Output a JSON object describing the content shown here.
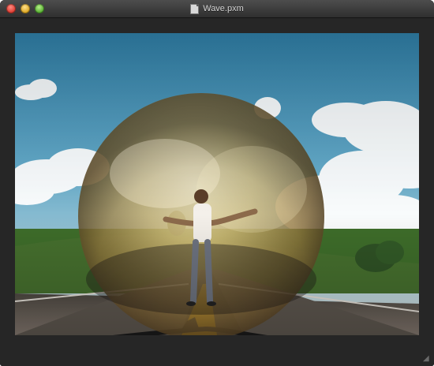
{
  "window": {
    "title": "Wave.pxm"
  },
  "controls": {
    "close": "close-icon",
    "minimize": "minimize-icon",
    "zoom": "zoom-icon"
  },
  "colors": {
    "window_background": "#262626",
    "sky_top": "#3d86aa",
    "road": "#6f655d",
    "road_line": "#f0b000",
    "sphere_glow": "#f4d58a"
  },
  "image": {
    "description_icon": "photo-image-icon"
  },
  "statusbar": {
    "resize_grip_icon": "resize-grip-icon"
  }
}
